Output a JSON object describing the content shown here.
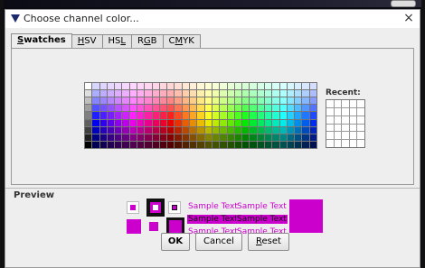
{
  "dialog": {
    "title": "Choose channel color...",
    "close_glyph": "×"
  },
  "tabs": [
    {
      "label": "Swatches",
      "mnemonic": "S",
      "rest": "watches",
      "active": true
    },
    {
      "label": "HSV",
      "mnemonic": "H",
      "rest": "SV",
      "active": false
    },
    {
      "label": "HSL",
      "mnemonic": "L",
      "rest": "HS",
      "active": false
    },
    {
      "label": "RGB",
      "mnemonic": "G",
      "rest": "R",
      "active": false
    },
    {
      "label": "CMYK",
      "mnemonic": "M",
      "rest": "C",
      "active": false
    }
  ],
  "swatches": {
    "recent_label": "Recent:"
  },
  "preview": {
    "label": "Preview",
    "sample_text": "Sample Text",
    "selected_color": "#CC00CC"
  },
  "buttons": {
    "ok": "OK",
    "cancel": "Cancel",
    "reset": "Reset",
    "reset_mnemonic": "R",
    "reset_rest": "eset"
  },
  "icons": [
    "window-icon",
    "close-icon"
  ]
}
